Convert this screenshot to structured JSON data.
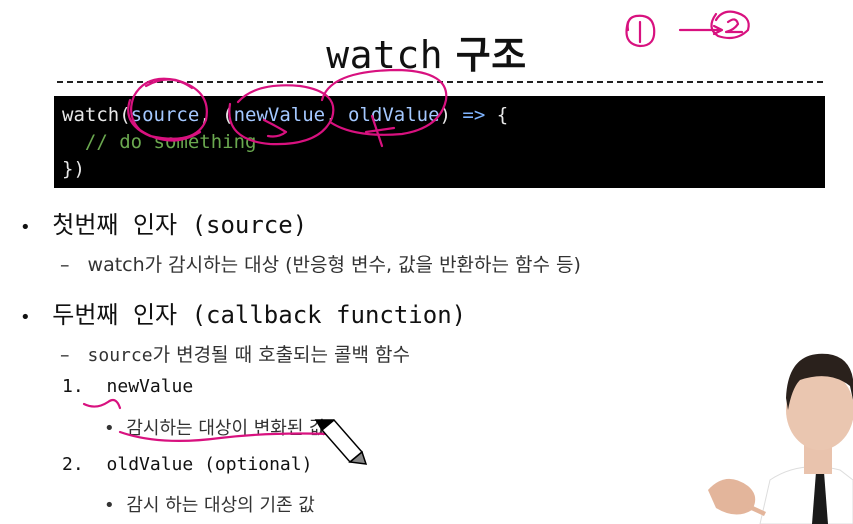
{
  "slide": {
    "title_code": "watch",
    "title_text": "구조",
    "code": {
      "fn": "watch(",
      "arg1": "source",
      "sep1": ", (",
      "arg2": "newValue",
      "sep2": ", ",
      "arg3": "oldValue",
      "sep3": ") ",
      "arrow": "=>",
      "brace_open": " {",
      "comment": "  // do something",
      "brace_close": "})"
    },
    "bullets": [
      {
        "heading": "첫번째 인자 (source)",
        "sub": "watch가 감시하는 대상 (반응형 변수, 값을 반환하는 함수 등)"
      },
      {
        "heading": "두번째 인자 (callback function)",
        "sub_code": "source",
        "sub_text": "가 변경될 때  호출되는 콜백 함수",
        "items": [
          {
            "num": "1.",
            "label": "newValue",
            "desc": "감시하는 대상이 변화된 값"
          },
          {
            "num": "2.",
            "label": "oldValue (optional)",
            "desc": "감시 하는 대상의 기존 값"
          }
        ]
      }
    ]
  }
}
